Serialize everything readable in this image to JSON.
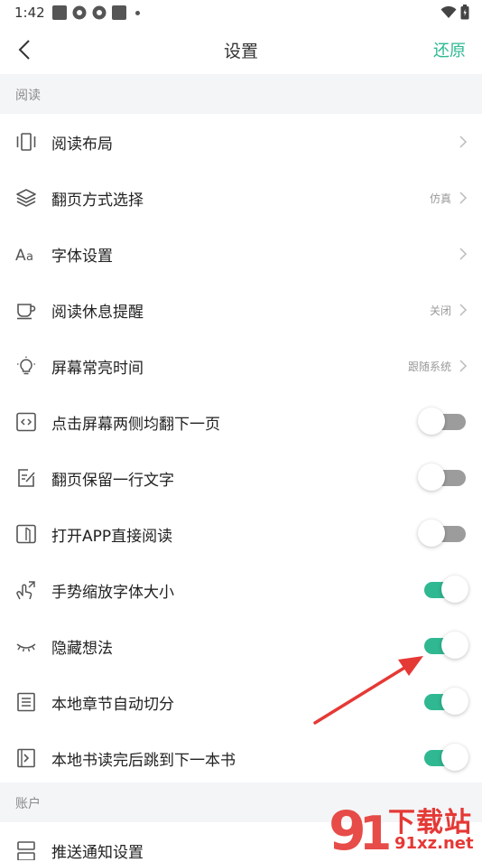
{
  "status_bar": {
    "time": "1:42"
  },
  "header": {
    "title": "设置",
    "restore_label": "还原"
  },
  "sections": {
    "reading": "阅读",
    "account": "账户"
  },
  "rows": [
    {
      "label": "阅读布局",
      "value": "",
      "type": "chevron",
      "icon": "layout-icon"
    },
    {
      "label": "翻页方式选择",
      "value": "仿真",
      "type": "chevron",
      "icon": "layers-icon"
    },
    {
      "label": "字体设置",
      "value": "",
      "type": "chevron",
      "icon": "font-icon"
    },
    {
      "label": "阅读休息提醒",
      "value": "关闭",
      "type": "chevron",
      "icon": "cup-icon"
    },
    {
      "label": "屏幕常亮时间",
      "value": "跟随系统",
      "type": "chevron",
      "icon": "lightbulb-icon"
    },
    {
      "label": "点击屏幕两侧均翻下一页",
      "type": "toggle",
      "on": false,
      "icon": "code-icon"
    },
    {
      "label": "翻页保留一行文字",
      "type": "toggle",
      "on": false,
      "icon": "edit-doc-icon"
    },
    {
      "label": "打开APP直接阅读",
      "type": "toggle",
      "on": false,
      "icon": "book-icon"
    },
    {
      "label": "手势缩放字体大小",
      "type": "toggle",
      "on": true,
      "icon": "gesture-icon"
    },
    {
      "label": "隐藏想法",
      "type": "toggle",
      "on": true,
      "icon": "eye-closed-icon"
    },
    {
      "label": "本地章节自动切分",
      "type": "toggle",
      "on": true,
      "icon": "list-icon"
    },
    {
      "label": "本地书读完后跳到下一本书",
      "type": "toggle",
      "on": true,
      "icon": "next-book-icon"
    },
    {
      "label": "推送通知设置",
      "type": "chevron",
      "value": "",
      "icon": "notification-icon"
    }
  ],
  "watermark": {
    "text": "下载站",
    "url": "91xz.net"
  },
  "colors": {
    "accent": "#2fb892",
    "arrow": "#e53935"
  }
}
